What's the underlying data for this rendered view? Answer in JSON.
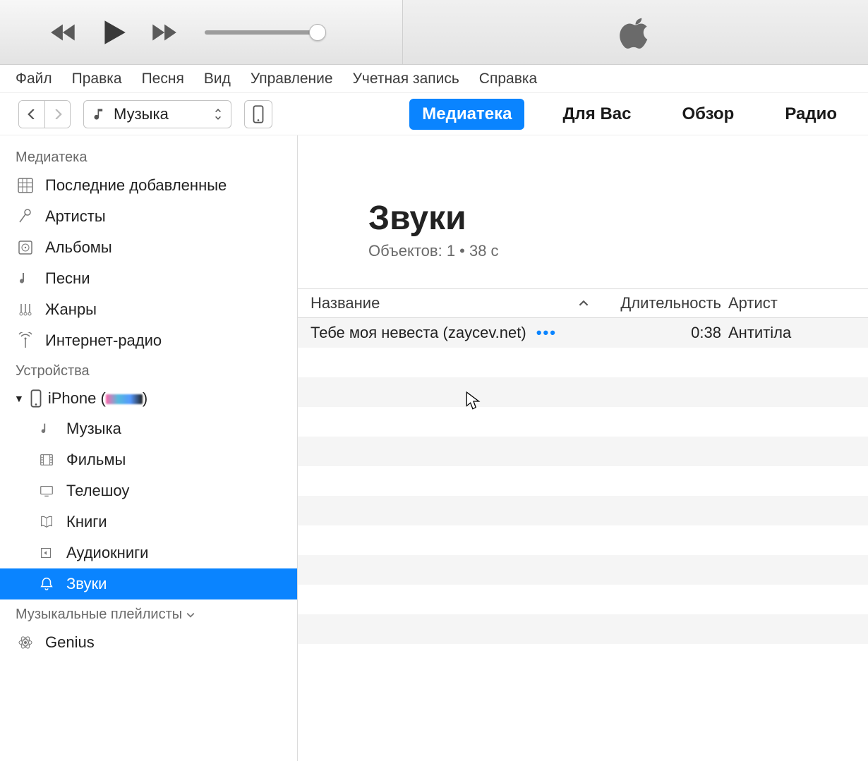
{
  "menu": [
    "Файл",
    "Правка",
    "Песня",
    "Вид",
    "Управление",
    "Учетная запись",
    "Справка"
  ],
  "toolbar": {
    "source_label": "Музыка"
  },
  "tabs": [
    {
      "label": "Медиатека",
      "active": true
    },
    {
      "label": "Для Вас",
      "active": false
    },
    {
      "label": "Обзор",
      "active": false
    },
    {
      "label": "Радио",
      "active": false
    }
  ],
  "sidebar": {
    "library_heading": "Медиатека",
    "library_items": [
      {
        "id": "recent",
        "label": "Последние добавленные"
      },
      {
        "id": "artists",
        "label": "Артисты"
      },
      {
        "id": "albums",
        "label": "Альбомы"
      },
      {
        "id": "songs",
        "label": "Песни"
      },
      {
        "id": "genres",
        "label": "Жанры"
      },
      {
        "id": "iradio",
        "label": "Интернет-радио"
      }
    ],
    "devices_heading": "Устройства",
    "device_name_prefix": "iPhone (",
    "device_name_suffix": ")",
    "device_items": [
      {
        "id": "d-music",
        "label": "Музыка"
      },
      {
        "id": "d-movies",
        "label": "Фильмы"
      },
      {
        "id": "d-tvshows",
        "label": "Телешоу"
      },
      {
        "id": "d-books",
        "label": "Книги"
      },
      {
        "id": "d-abooks",
        "label": "Аудиокниги"
      },
      {
        "id": "d-tones",
        "label": "Звуки",
        "selected": true
      }
    ],
    "playlists_heading": "Музыкальные плейлисты",
    "genius_label": "Genius"
  },
  "content": {
    "title": "Звуки",
    "subtitle": "Объектов: 1 • 38 c",
    "columns": {
      "title": "Название",
      "duration": "Длительность",
      "artist": "Артист"
    },
    "rows": [
      {
        "title": "Тебе моя невеста (zaycev.net)",
        "duration": "0:38",
        "artist": "Антитіла"
      }
    ]
  }
}
